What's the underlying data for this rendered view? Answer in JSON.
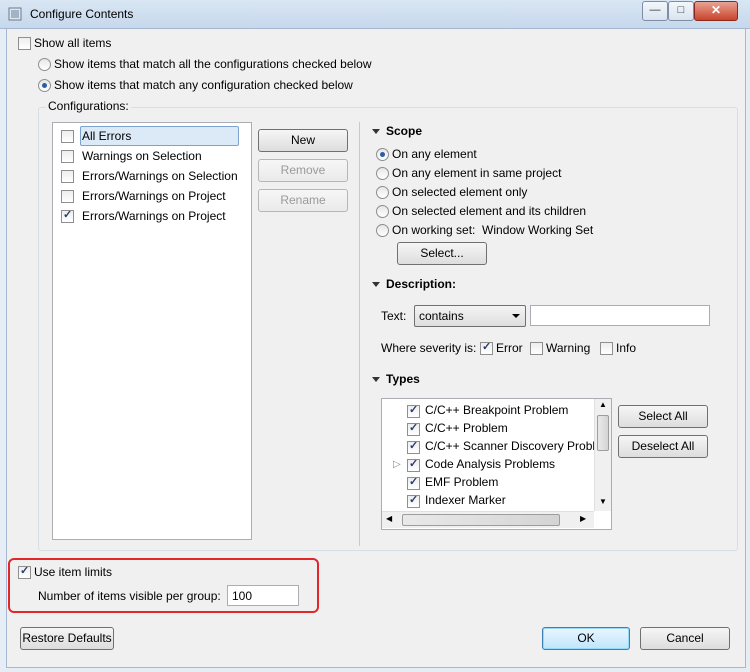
{
  "window": {
    "title": "Configure Contents",
    "controls": {
      "minimize_icon": "minimize-icon",
      "maximize_icon": "maximize-icon",
      "close_icon": "close-icon"
    }
  },
  "show_all_items": {
    "label": "Show all items",
    "checked": false
  },
  "match_options": [
    {
      "label": "Show items that match all the configurations checked below",
      "selected": false
    },
    {
      "label": "Show items that match any configuration checked below",
      "selected": true
    }
  ],
  "configurations": {
    "label": "Configurations:",
    "items": [
      {
        "label": "All Errors",
        "checked": false,
        "selected": true
      },
      {
        "label": "Warnings on Selection",
        "checked": false,
        "selected": false
      },
      {
        "label": "Errors/Warnings on Selection",
        "checked": false,
        "selected": false
      },
      {
        "label": "Errors/Warnings on Project",
        "checked": false,
        "selected": false
      },
      {
        "label": "Errors/Warnings on Project",
        "checked": true,
        "selected": false
      }
    ],
    "buttons": {
      "new": "New",
      "remove": "Remove",
      "rename": "Rename"
    }
  },
  "scope": {
    "title": "Scope",
    "options": [
      {
        "label": "On any element",
        "selected": true
      },
      {
        "label": "On any element in same project",
        "selected": false
      },
      {
        "label": "On selected element only",
        "selected": false
      },
      {
        "label": "On selected element and its children",
        "selected": false
      },
      {
        "label": "On working set:  Window Working Set",
        "selected": false
      }
    ],
    "select_button": "Select..."
  },
  "description": {
    "title": "Description:",
    "text_label": "Text:",
    "operator": "contains",
    "text_value": "",
    "severity_label": "Where severity is:",
    "severities": [
      {
        "label": "Error",
        "checked": true
      },
      {
        "label": "Warning",
        "checked": false
      },
      {
        "label": "Info",
        "checked": false
      }
    ]
  },
  "types": {
    "title": "Types",
    "items": [
      {
        "label": "C/C++ Breakpoint Problem",
        "checked": true,
        "expandable": false
      },
      {
        "label": "C/C++ Problem",
        "checked": true,
        "expandable": false
      },
      {
        "label": "C/C++ Scanner Discovery Probl",
        "checked": true,
        "expandable": false
      },
      {
        "label": "Code Analysis Problems",
        "checked": true,
        "expandable": true
      },
      {
        "label": "EMF Problem",
        "checked": true,
        "expandable": false
      },
      {
        "label": "Indexer Marker",
        "checked": true,
        "expandable": false
      }
    ],
    "select_all": "Select All",
    "deselect_all": "Deselect All"
  },
  "limits": {
    "use_limits_label": "Use item limits",
    "use_limits_checked": true,
    "count_label": "Number of items visible per group:",
    "count_value": "100"
  },
  "footer": {
    "restore_defaults": "Restore Defaults",
    "ok": "OK",
    "cancel": "Cancel"
  },
  "colors": {
    "highlight": "#e2262a",
    "accent": "#3c7fb1"
  }
}
